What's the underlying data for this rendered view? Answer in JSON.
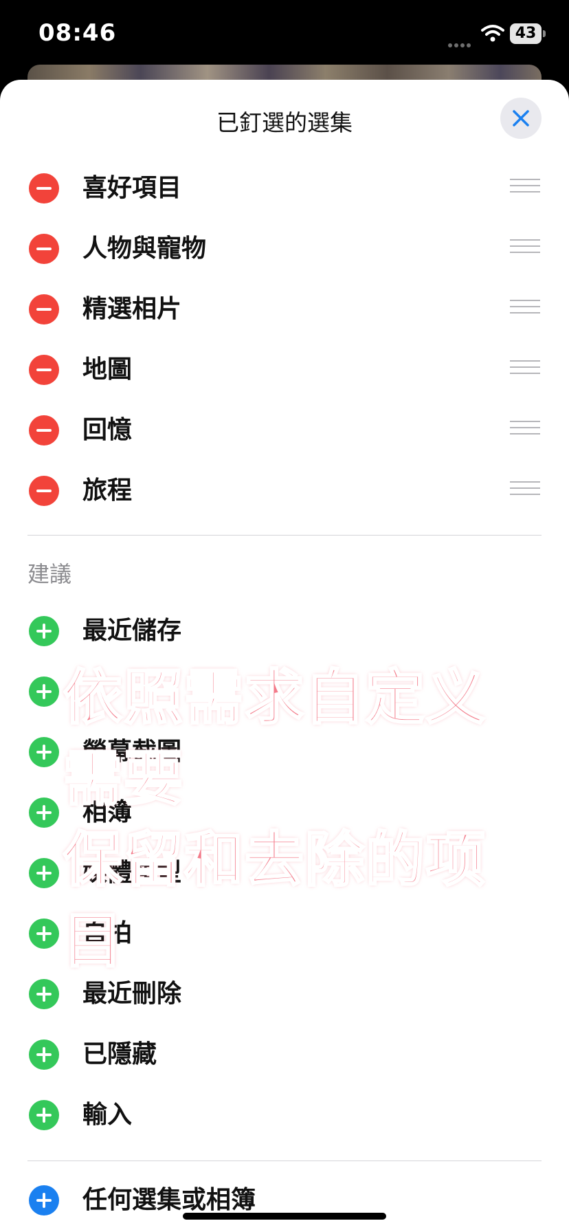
{
  "status_bar": {
    "time": "08:46",
    "battery": "43"
  },
  "sheet": {
    "title": "已釘選的選集",
    "close_label": "×"
  },
  "pinned": [
    {
      "label": "喜好項目"
    },
    {
      "label": "人物與寵物"
    },
    {
      "label": "精選相片"
    },
    {
      "label": "地圖"
    },
    {
      "label": "回憶"
    },
    {
      "label": "旅程"
    }
  ],
  "suggestions_header": "建議",
  "suggestions": [
    {
      "label": "最近儲存"
    },
    {
      "label": ""
    },
    {
      "label": "螢幕截圖"
    },
    {
      "label": "相簿"
    },
    {
      "label": "媒體類型"
    },
    {
      "label": "自拍"
    },
    {
      "label": "最近刪除"
    },
    {
      "label": "已隱藏"
    },
    {
      "label": "輸入"
    }
  ],
  "any_collection": {
    "label": "任何選集或相簿"
  },
  "overlay_caption": {
    "line1": "依照需求自定义需要",
    "line2": "保留和去除的项目"
  },
  "colors": {
    "remove": "#f2433a",
    "add": "#34c85a",
    "add_blue": "#1a80f0",
    "close_x": "#1a80f0",
    "caption": "#f37b8a"
  },
  "icons": {
    "close": "xmark-icon",
    "remove": "minus-circle-icon",
    "add": "plus-circle-icon",
    "reorder": "reorder-handle-icon"
  }
}
